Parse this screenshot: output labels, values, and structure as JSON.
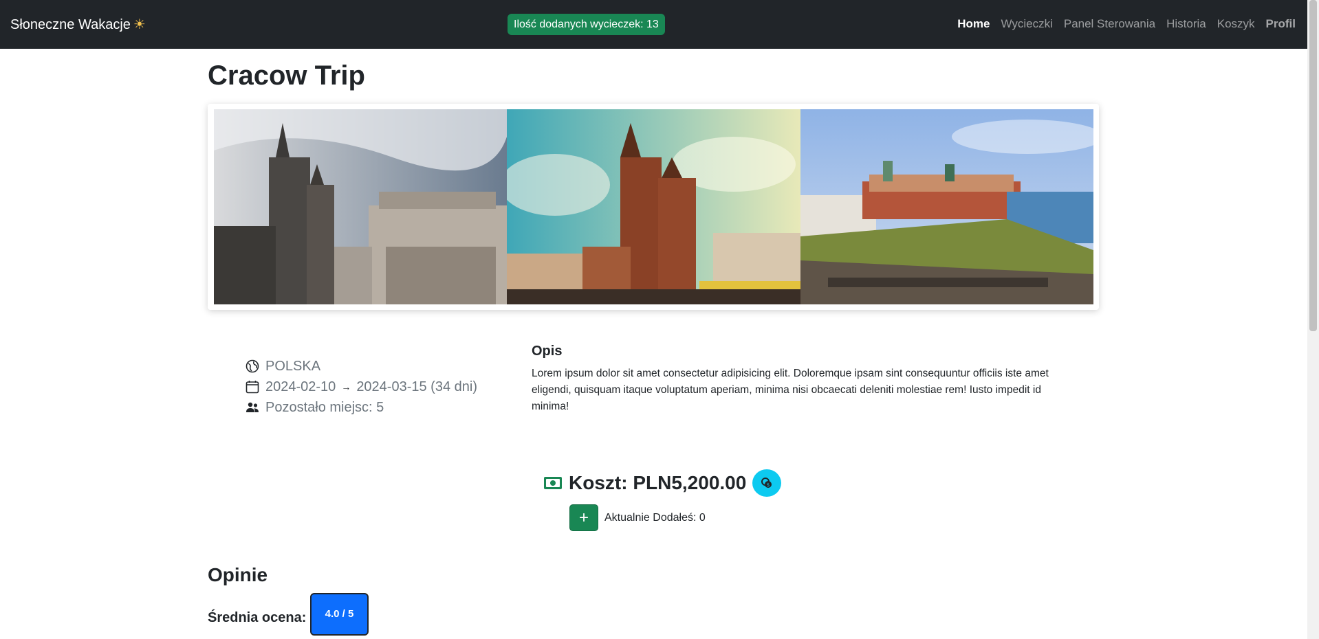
{
  "navbar": {
    "brand": "Słoneczne Wakacje",
    "brand_icon": "sun-icon",
    "trips_badge": "Ilość dodanych wycieczek: 13",
    "links": [
      {
        "label": "Home",
        "active": true
      },
      {
        "label": "Wycieczki"
      },
      {
        "label": "Panel Sterowania"
      },
      {
        "label": "Historia"
      },
      {
        "label": "Koszyk"
      },
      {
        "label": "Profil"
      }
    ]
  },
  "trip": {
    "title": "Cracow Trip",
    "country": "POLSKA",
    "date_start": "2024-02-10",
    "date_end": "2024-03-15 (34 dni)",
    "seats_left": "Pozostało miejsc: 5",
    "description_heading": "Opis",
    "description": "Lorem ipsum dolor sit amet consectetur adipisicing elit. Doloremque ipsam sint consequuntur officiis iste amet eligendi, quisquam itaque voluptatum aperiam, minima nisi obcaecati deleniti molestiae rem! Iusto impedit id minima!",
    "cost": "Koszt: PLN5,200.00",
    "add_button": "+",
    "added_count": "Aktualnie Dodałeś: 0"
  },
  "reviews": {
    "title": "Opinie",
    "average_label": "Średnia ocena:",
    "average_value": "4.0 / 5"
  },
  "colors": {
    "navbar_bg": "#212529",
    "success": "#198754",
    "info": "#0dcaf0",
    "primary": "#0d6efd"
  }
}
